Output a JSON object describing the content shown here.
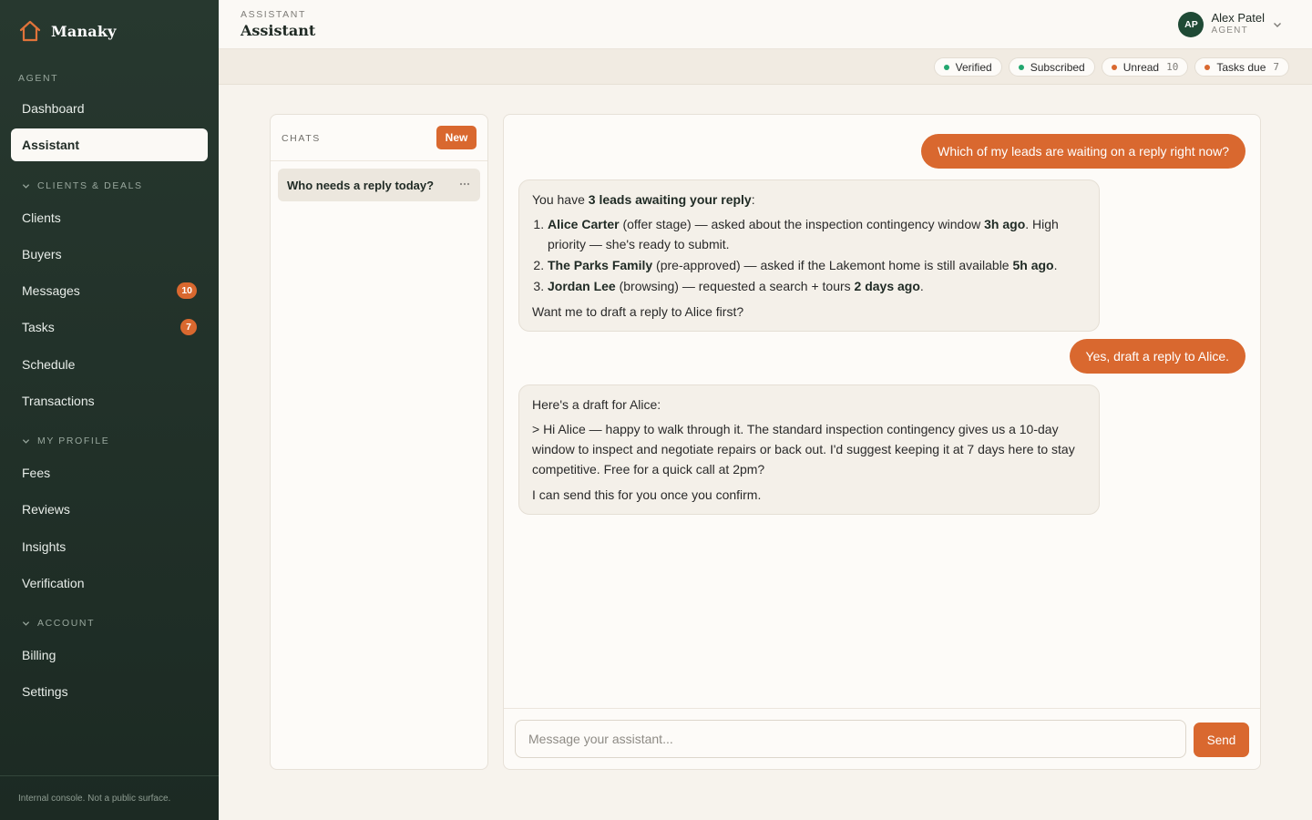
{
  "brand": {
    "name": "Manaky",
    "icon": "house-icon"
  },
  "sidebar": {
    "sections": [
      {
        "label": "AGENT"
      },
      {
        "label": "CLIENTS & DEALS"
      },
      {
        "label": "MY PROFILE"
      },
      {
        "label": "ACCOUNT"
      }
    ],
    "items": [
      {
        "label": "Dashboard"
      },
      {
        "label": "Assistant",
        "active": true
      },
      {
        "label": "Clients"
      },
      {
        "label": "Buyers"
      },
      {
        "label": "Messages",
        "badge": "10"
      },
      {
        "label": "Tasks",
        "badge": "7"
      },
      {
        "label": "Schedule"
      },
      {
        "label": "Transactions"
      },
      {
        "label": "Fees"
      },
      {
        "label": "Reviews"
      },
      {
        "label": "Insights"
      },
      {
        "label": "Verification"
      },
      {
        "label": "Billing"
      },
      {
        "label": "Settings"
      }
    ],
    "footer": "Internal console. Not a public surface."
  },
  "header": {
    "eyebrow": "ASSISTANT",
    "title": "Assistant",
    "user": {
      "initials": "AP",
      "name": "Alex Patel",
      "role": "AGENT"
    }
  },
  "status": {
    "pills": [
      {
        "label": "Verified",
        "dot": "#22a66e"
      },
      {
        "label": "Subscribed",
        "dot": "#22a66e"
      },
      {
        "label": "Unread",
        "count": "10",
        "dot": "#d9682f"
      },
      {
        "label": "Tasks due",
        "count": "7",
        "dot": "#d9682f"
      }
    ]
  },
  "chats": {
    "label": "CHATS",
    "new_label": "New",
    "items": [
      {
        "title": "Who needs a reply today?"
      }
    ]
  },
  "conversation": {
    "messages": [
      {
        "role": "user",
        "text": "Which of my leads are waiting on a reply right now?"
      },
      {
        "role": "assistant",
        "intro_pre": "You have ",
        "intro_bold": "3 leads awaiting your reply",
        "intro_post": ":",
        "list": [
          {
            "name": "Alice Carter",
            "mid": " (offer stage) — asked about the inspection contingency window ",
            "time": "3h ago",
            "tail": ". High priority — she's ready to submit."
          },
          {
            "name": "The Parks Family",
            "mid": " (pre-approved) — asked if the Lakemont home is still available ",
            "time": "5h ago",
            "tail": "."
          },
          {
            "name": "Jordan Lee",
            "mid": " (browsing) — requested a search + tours ",
            "time": "2 days ago",
            "tail": "."
          }
        ],
        "outro": "Want me to draft a reply to Alice first?"
      },
      {
        "role": "user",
        "text": "Yes, draft a reply to Alice."
      },
      {
        "role": "assistant",
        "intro": "Here's a draft for Alice:",
        "draft": "> Hi Alice — happy to walk through it. The standard inspection contingency gives us a 10-day window to inspect and negotiate repairs or back out. I'd suggest keeping it at 7 days here to stay competitive. Free for a quick call at 2pm?",
        "outro": "I can send this for you once you confirm."
      }
    ]
  },
  "composer": {
    "placeholder": "Message your assistant...",
    "value": "",
    "send_label": "Send"
  },
  "colors": {
    "accent": "#d9682f",
    "sidebar_bg": "#243329",
    "success": "#22a66e"
  }
}
